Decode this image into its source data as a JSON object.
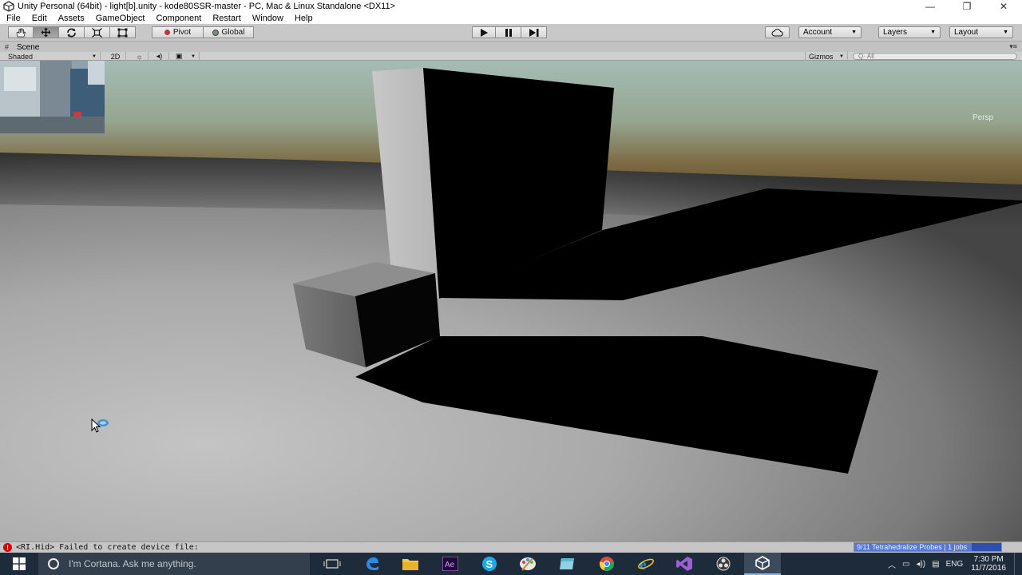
{
  "window": {
    "title": "Unity Personal (64bit) - light[b].unity - kode80SSR-master - PC, Mac & Linux Standalone <DX11>",
    "minimize_glyph": "—",
    "maximize_glyph": "❐",
    "close_glyph": "✕"
  },
  "menu": [
    "File",
    "Edit",
    "Assets",
    "GameObject",
    "Component",
    "Restart",
    "Window",
    "Help"
  ],
  "toolbar": {
    "pivot_label": "Pivot",
    "global_label": "Global",
    "account_label": "Account",
    "layers_label": "Layers",
    "layout_label": "Layout"
  },
  "scene": {
    "tab_label": "Scene",
    "shading_mode": "Shaded",
    "mode_2d": "2D",
    "gizmos_label": "Gizmos",
    "search_placeholder": "All",
    "persp_label": "Persp"
  },
  "status": {
    "message": "<RI.Hid> Failed to create device file:",
    "progress_label": "9/11 Tetrahedralize Probes | 1 jobs",
    "progress_fraction": 0.8
  },
  "taskbar": {
    "cortana_placeholder": "I'm Cortana. Ask me anything.",
    "apps": [
      "task-view",
      "edge",
      "file-explorer",
      "after-effects",
      "skype",
      "paint",
      "notepad",
      "chrome",
      "internet-explorer",
      "visual-studio",
      "unity-hub",
      "unity"
    ],
    "language": "ENG",
    "time": "7:30 PM",
    "date": "11/7/2016"
  },
  "colors": {
    "unity_chrome": "#c2c2c2",
    "sky_top": "#9fb7b1",
    "horizon": "#6b5a36",
    "taskbar": "#1e2b3a",
    "error_red": "#d40000"
  }
}
